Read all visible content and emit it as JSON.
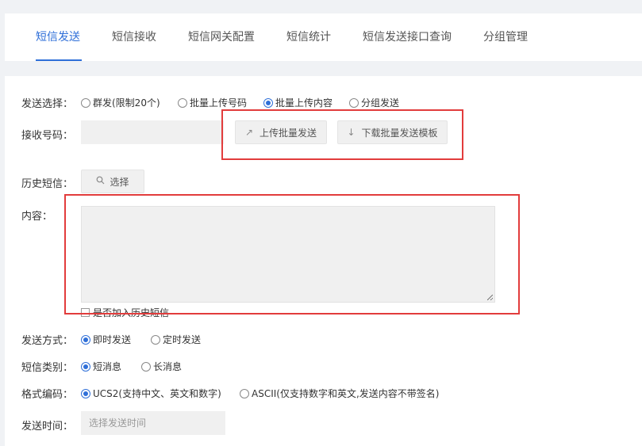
{
  "tabs": [
    {
      "label": "短信发送",
      "active": true
    },
    {
      "label": "短信接收",
      "active": false
    },
    {
      "label": "短信网关配置",
      "active": false
    },
    {
      "label": "短信统计",
      "active": false
    },
    {
      "label": "短信发送接口查询",
      "active": false
    },
    {
      "label": "分组管理",
      "active": false
    }
  ],
  "form": {
    "send_select": {
      "label": "发送选择：",
      "options": [
        {
          "label": "群发(限制20个)",
          "checked": false
        },
        {
          "label": "批量上传号码",
          "checked": false
        },
        {
          "label": "批量上传内容",
          "checked": true
        },
        {
          "label": "分组发送",
          "checked": false
        }
      ]
    },
    "recipient": {
      "label": "接收号码：",
      "value": "",
      "upload_button": "上传批量发送",
      "download_button": "下载批量发送模板"
    },
    "history": {
      "label": "历史短信：",
      "select_button": "选择"
    },
    "content": {
      "label": "内容：",
      "value": "",
      "add_to_history_label": "是否加入历史短信",
      "add_to_history_checked": false
    },
    "send_method": {
      "label": "发送方式：",
      "options": [
        {
          "label": "即时发送",
          "checked": true
        },
        {
          "label": "定时发送",
          "checked": false
        }
      ]
    },
    "sms_type": {
      "label": "短信类别：",
      "options": [
        {
          "label": "短消息",
          "checked": true
        },
        {
          "label": "长消息",
          "checked": false
        }
      ]
    },
    "encoding": {
      "label": "格式编码：",
      "options": [
        {
          "label": "UCS2(支持中文、英文和数字)",
          "checked": true
        },
        {
          "label": "ASCII(仅支持数字和英文,发送内容不带签名)",
          "checked": false
        }
      ]
    },
    "send_time": {
      "label": "发送时间：",
      "placeholder": "选择发送时间"
    }
  },
  "colors": {
    "accent": "#2f6fd8",
    "highlight_box": "#e23c3c",
    "input_bg": "#f0f0f0",
    "page_bg": "#f0f2f5"
  },
  "icons": {
    "upload": "arrow-up-right-icon",
    "download": "arrow-down-icon",
    "search": "search-icon"
  }
}
